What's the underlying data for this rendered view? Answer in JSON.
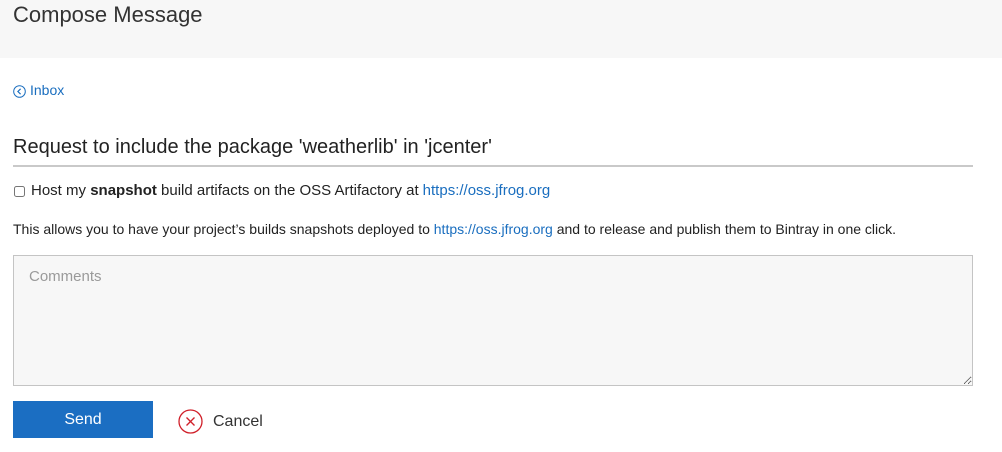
{
  "header": {
    "title": "Compose Message"
  },
  "nav": {
    "back_label": "Inbox",
    "back_icon": "chevron-left-circle-icon"
  },
  "message": {
    "subject": "Request to include the package 'weatherlib' in 'jcenter'",
    "snapshot": {
      "checked": false,
      "text_before": "Host my ",
      "text_bold": "snapshot",
      "text_after": " build artifacts on the OSS Artifactory at ",
      "link": "https://oss.jfrog.org"
    },
    "info": {
      "text_before": "This allows you to have your project’s builds snapshots deployed to ",
      "link": "https://oss.jfrog.org",
      "text_after": " and to release and publish them to Bintray in one click."
    },
    "comments": {
      "placeholder": "Comments",
      "value": ""
    }
  },
  "actions": {
    "send_label": "Send",
    "cancel_label": "Cancel",
    "cancel_icon": "close-circle-icon"
  },
  "colors": {
    "accent": "#1b6ec2",
    "link": "#1a6ebf",
    "cancel_icon": "#d0202a",
    "header_bg": "#f7f7f7"
  }
}
